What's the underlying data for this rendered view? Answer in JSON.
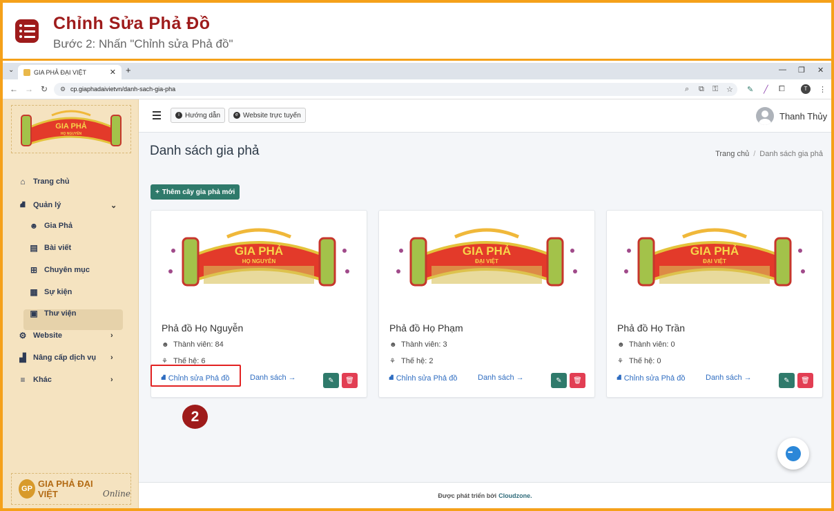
{
  "tutorial": {
    "title": "Chỉnh Sửa Phả Đồ",
    "subtitle": "Bước 2: Nhấn \"Chỉnh sửa Phả đồ\"",
    "step_number": "2"
  },
  "browser": {
    "tab_title": "GIA PHẢ ĐẠI VIỆT",
    "url": "cp.giaphadaivietvn/danh-sach-gia-pha",
    "profile_initial": "T"
  },
  "sidebar": {
    "items": [
      {
        "label": "Trang chủ",
        "icon": "home-icon"
      },
      {
        "label": "Quản lý",
        "icon": "sitemap-icon"
      },
      {
        "label": "Gia Phả",
        "icon": "users-icon"
      },
      {
        "label": "Bài viết",
        "icon": "newspaper-icon"
      },
      {
        "label": "Chuyên mục",
        "icon": "grid-icon"
      },
      {
        "label": "Sự kiện",
        "icon": "calendar-icon"
      },
      {
        "label": "Thư viện",
        "icon": "images-icon"
      },
      {
        "label": "Website",
        "icon": "gear-icon"
      },
      {
        "label": "Nâng cấp dịch vụ",
        "icon": "chart-icon"
      },
      {
        "label": "Khác",
        "icon": "menu-icon"
      }
    ],
    "footer_logo": "GIA PHẢ ĐẠI VIỆT",
    "footer_logo_badge": "GP",
    "footer_logo_script": "Online"
  },
  "topnav": {
    "guide_label": "Hướng dẫn",
    "website_label": "Website trực tuyến",
    "user_name": "Thanh Thủy"
  },
  "page": {
    "title": "Danh sách gia phả",
    "breadcrumb_home": "Trang chủ",
    "breadcrumb_current": "Danh sách gia phả",
    "add_button": "Thêm cây gia phả mới"
  },
  "cards": [
    {
      "banner_title": "GIA PHẢ",
      "banner_sub": "HỌ NGUYỄN",
      "name": "Phả đồ Họ Nguyễn",
      "members": "Thành viên: 84",
      "generations": "Thế hệ: 6",
      "edit_link": "Chỉnh sửa Phả đồ",
      "list_link": "Danh sách"
    },
    {
      "banner_title": "GIA PHẢ",
      "banner_sub": "ĐẠI VIỆT",
      "name": "Phả đồ Họ Phạm",
      "members": "Thành viên: 3",
      "generations": "Thế hệ: 2",
      "edit_link": "Chỉnh sửa Phả đồ",
      "list_link": "Danh sách"
    },
    {
      "banner_title": "GIA PHẢ",
      "banner_sub": "ĐẠI VIỆT",
      "name": "Phả đồ Họ Trần",
      "members": "Thành viên: 0",
      "generations": "Thế hệ: 0",
      "edit_link": "Chỉnh sửa Phả đồ",
      "list_link": "Danh sách"
    }
  ],
  "footer": {
    "text": "Được phát triển bởi",
    "brand": "Cloudzone."
  },
  "colors": {
    "accent": "#9e1b1b",
    "primary": "#2f7a6b",
    "danger": "#e23e53",
    "link": "#2f6dc1",
    "frame": "#f5a11a"
  }
}
